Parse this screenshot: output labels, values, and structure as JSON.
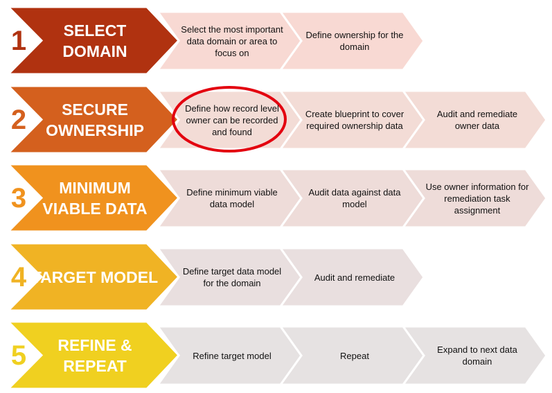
{
  "highlight_color": "#e3000f",
  "rows": [
    {
      "number": "1",
      "title": "SELECT DOMAIN",
      "color": "#b03210",
      "step_color": "#f8d9d3",
      "steps": [
        "Select the most important data domain or area to focus on",
        "Define ownership for the domain"
      ]
    },
    {
      "number": "2",
      "title": "SECURE OWNERSHIP",
      "color": "#d4601e",
      "step_color": "#f3dcd6",
      "steps": [
        "Define how record level owner can be recorded and found",
        "Create blueprint to cover required ownership data",
        "Audit and remediate owner data"
      ],
      "highlighted_step": 0
    },
    {
      "number": "3",
      "title": "MINIMUM VIABLE DATA",
      "color": "#f0921e",
      "step_color": "#eedcd9",
      "steps": [
        "Define minimum viable data model",
        "Audit data against data model",
        "Use owner information for remediation task assignment"
      ]
    },
    {
      "number": "4",
      "title": "TARGET MODEL",
      "color": "#f0b324",
      "step_color": "#e9dfdf",
      "steps": [
        "Define target data model for the domain",
        "Audit and remediate"
      ]
    },
    {
      "number": "5",
      "title": "REFINE & REPEAT",
      "color": "#f0d020",
      "step_color": "#e6e2e2",
      "steps": [
        "Refine target model",
        "Repeat",
        "Expand to next data domain"
      ]
    }
  ]
}
